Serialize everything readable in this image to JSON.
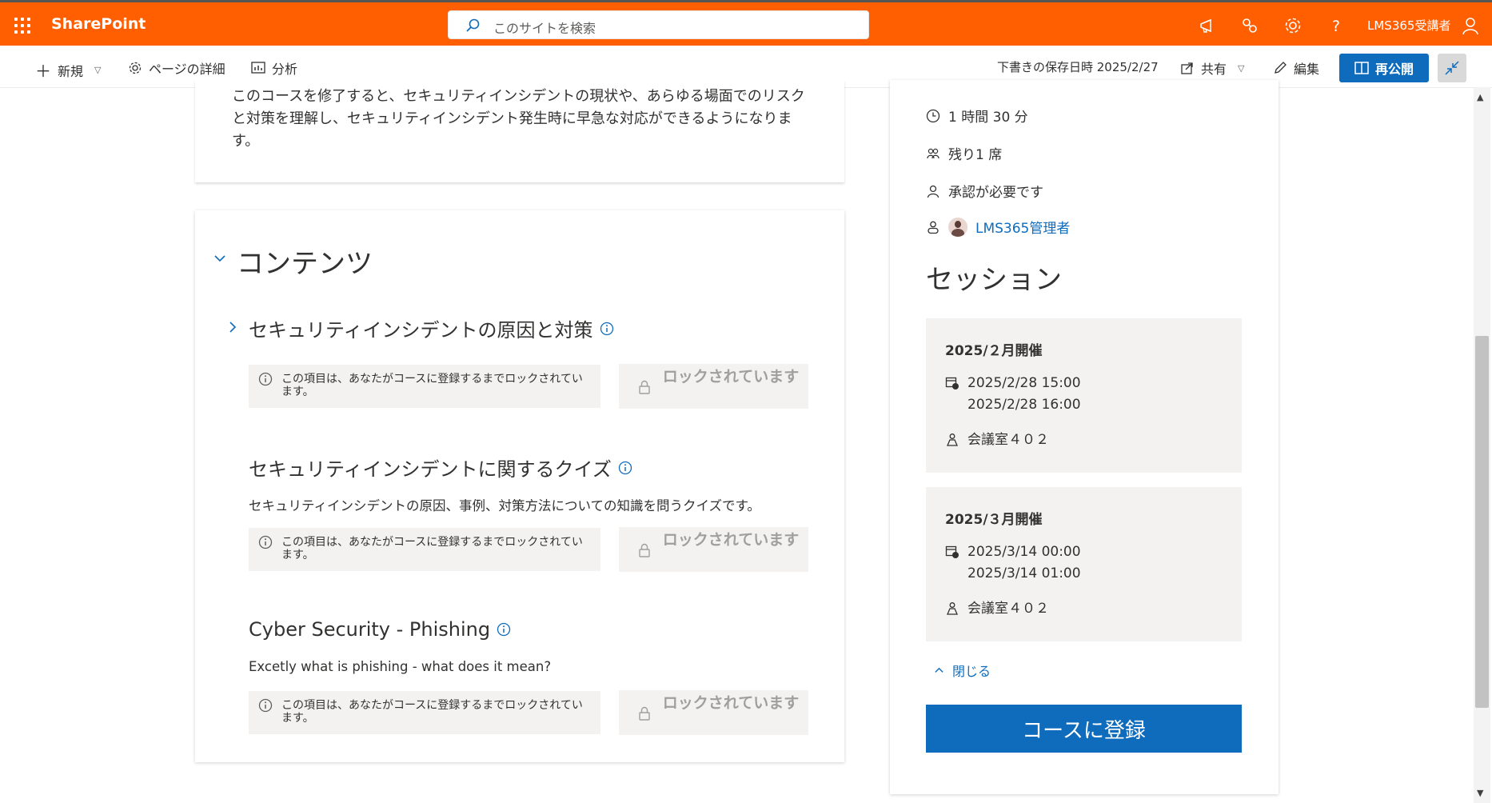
{
  "topbar": {
    "brand": "SharePoint",
    "search_placeholder": "このサイトを検索",
    "username": "LMS365受講者"
  },
  "cmdbar": {
    "new_label": "新規",
    "page_details_label": "ページの詳細",
    "analytics_label": "分析",
    "draft_saved": "下書きの保存日時 2025/2/27",
    "share_label": "共有",
    "edit_label": "編集",
    "republish_label": "再公開"
  },
  "course": {
    "description": "このコースを修了すると、セキュリティインシデントの現状や、あらゆる場面でのリスクと対策を理解し、セキュリティインシデント発生時に早急な対応ができるようになります。"
  },
  "contents": {
    "title": "コンテンツ",
    "lock_message": "この項目は、あなたがコースに登録するまでロックされています。",
    "lock_button": "ロックされています",
    "items": [
      {
        "title": "セキュリティインシデントの原因と対策",
        "description": ""
      },
      {
        "title": "セキュリティインシデントに関するクイズ",
        "description": "セキュリティインシデントの原因、事例、対策方法についての知識を問うクイズです。"
      },
      {
        "title": "Cyber Security - Phishing",
        "description": "Excetly what is phishing - what does it mean?"
      }
    ]
  },
  "panel": {
    "duration": "1 時間 30 分",
    "seats": "残り1 席",
    "approval": "承認が必要です",
    "admin": "LMS365管理者",
    "sessions_title": "セッション",
    "sessions": [
      {
        "name": "2025/２月開催",
        "start": "2025/2/28 15:00",
        "end": "2025/2/28 16:00",
        "room": "会議室４０２"
      },
      {
        "name": "2025/３月開催",
        "start": "2025/3/14 00:00",
        "end": "2025/3/14 01:00",
        "room": "会議室４０２"
      }
    ],
    "close_label": "閉じる",
    "enroll_label": "コースに登録"
  },
  "colors": {
    "accent": "#ff5f00",
    "primary": "#0f6cbd"
  }
}
